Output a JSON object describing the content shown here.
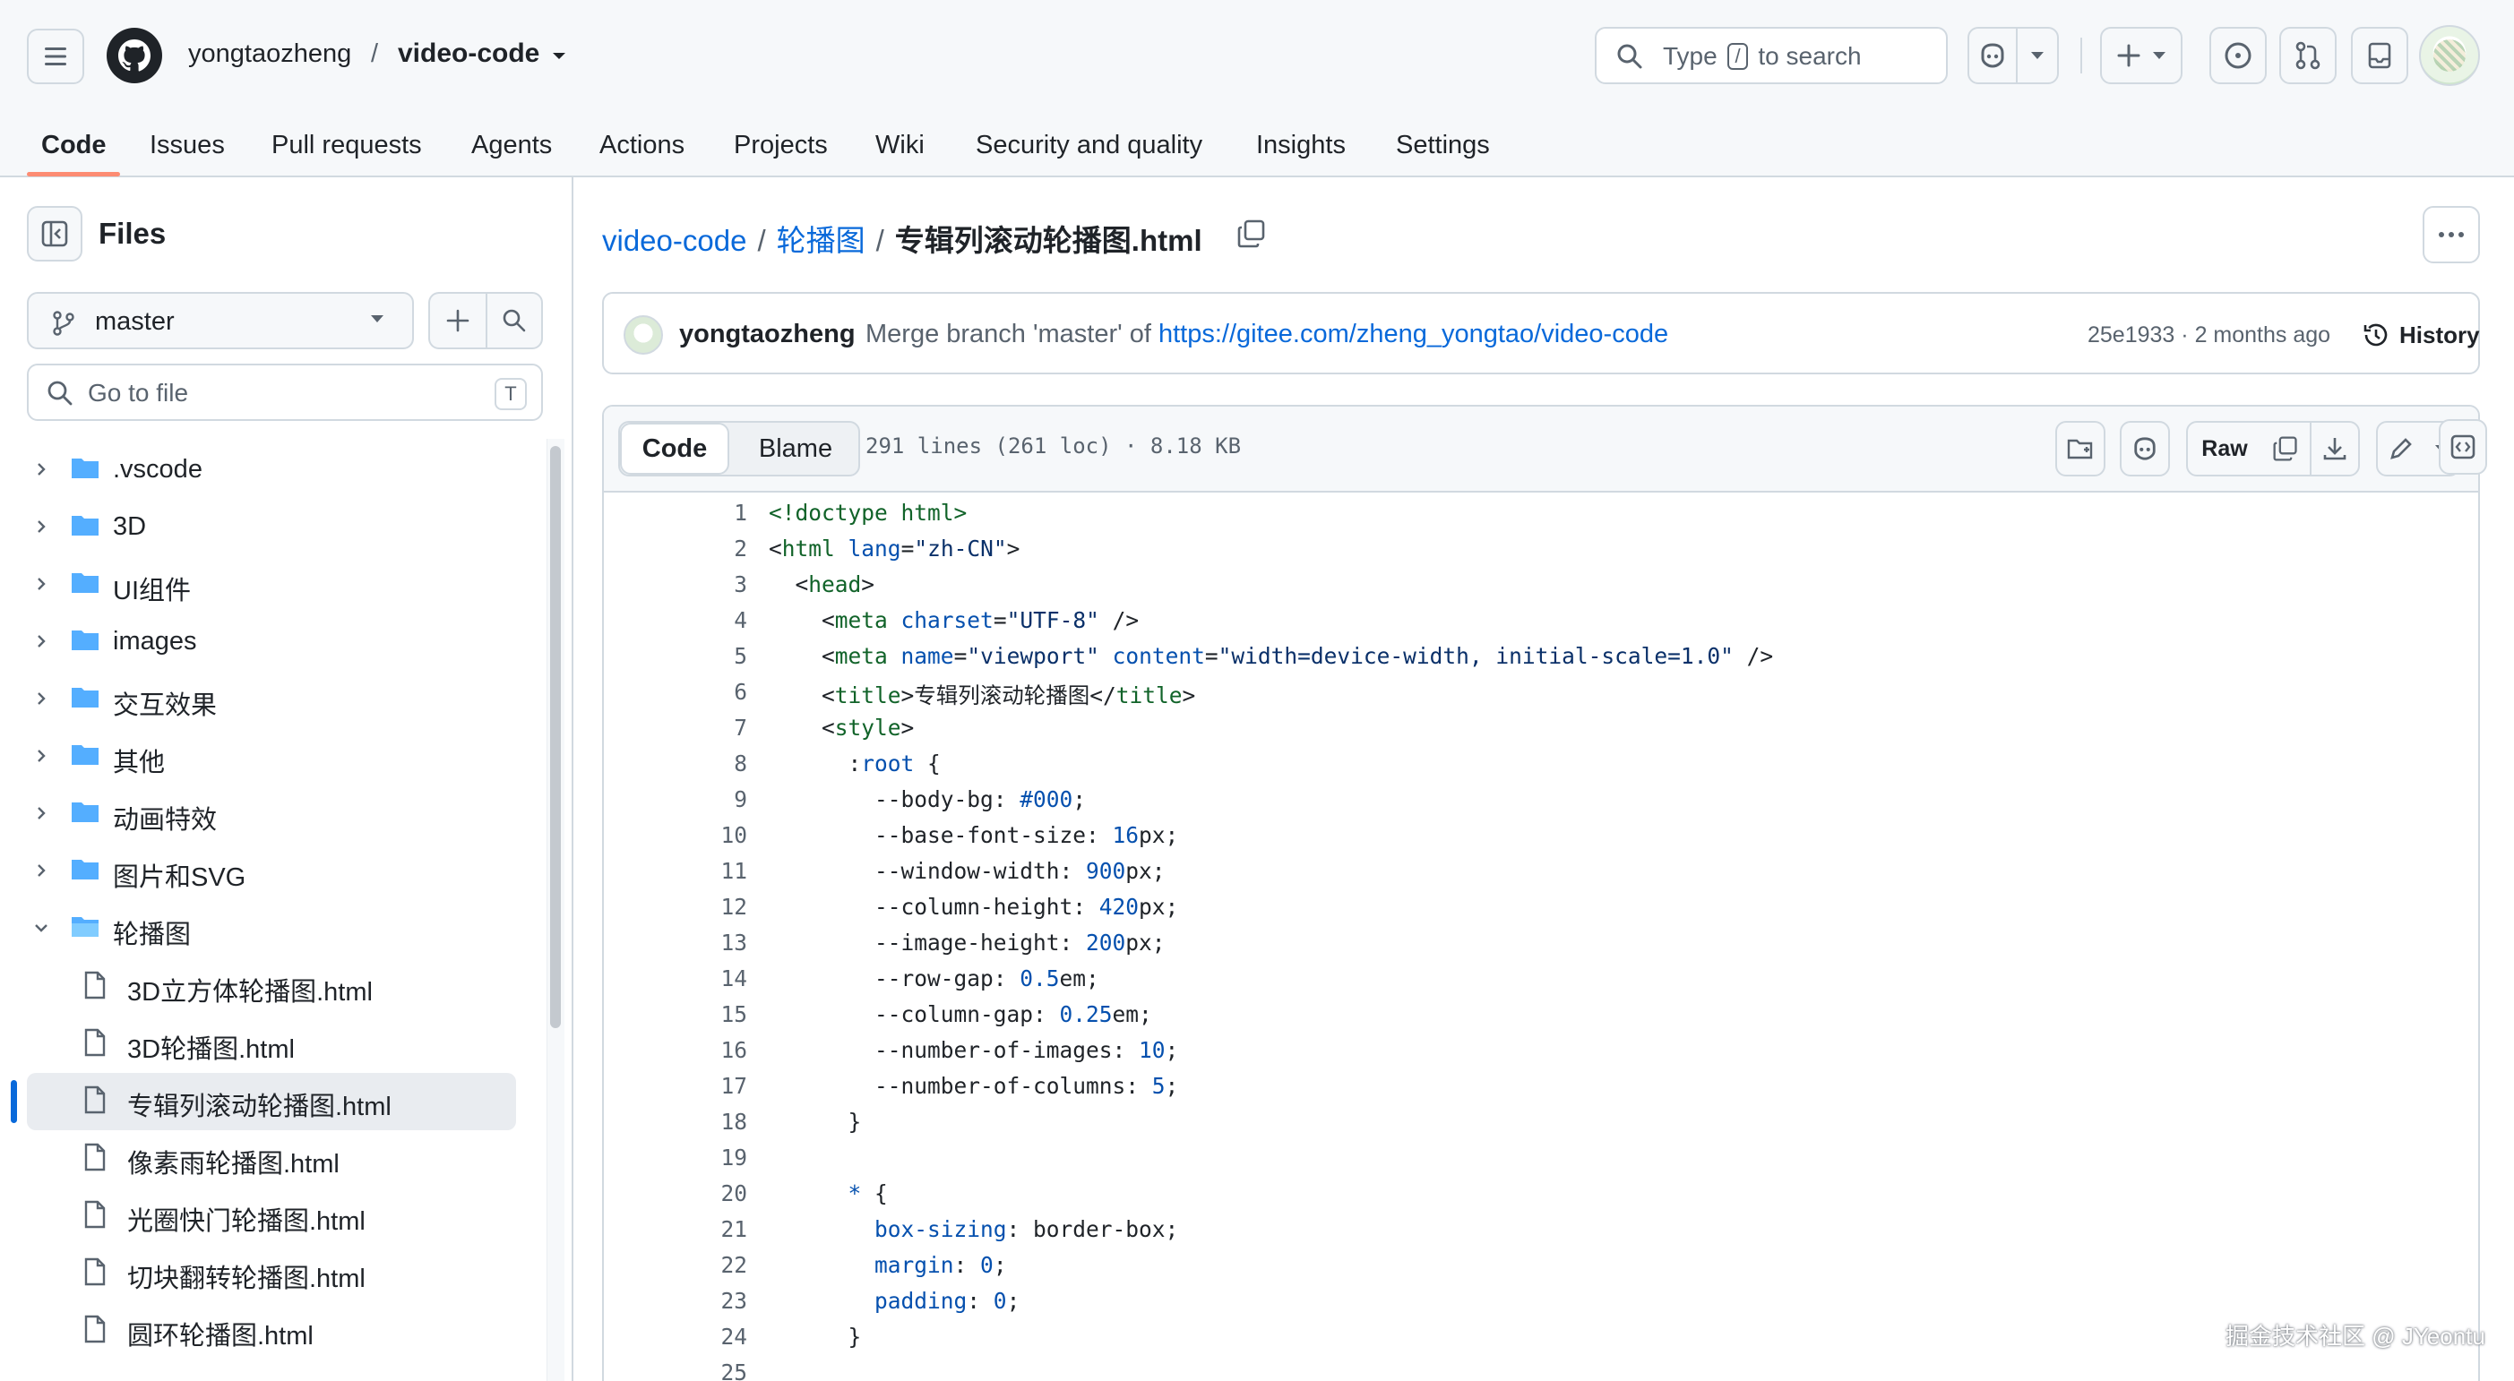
{
  "header": {
    "owner": "yongtaozheng",
    "separator": "/",
    "repo": "video-code",
    "search_prefix": "Type",
    "search_key": "/",
    "search_suffix": "to search",
    "tabs": [
      {
        "label": "Code",
        "active": true
      },
      {
        "label": "Issues"
      },
      {
        "label": "Pull requests"
      },
      {
        "label": "Agents"
      },
      {
        "label": "Actions"
      },
      {
        "label": "Projects"
      },
      {
        "label": "Wiki"
      },
      {
        "label": "Security and quality"
      },
      {
        "label": "Insights"
      },
      {
        "label": "Settings"
      }
    ]
  },
  "sidebar": {
    "title": "Files",
    "branch": "master",
    "goto_placeholder": "Go to file",
    "goto_key": "T",
    "tree": [
      {
        "type": "folder",
        "name": ".vscode",
        "expanded": false
      },
      {
        "type": "folder",
        "name": "3D",
        "expanded": false
      },
      {
        "type": "folder",
        "name": "UI组件",
        "expanded": false
      },
      {
        "type": "folder",
        "name": "images",
        "expanded": false
      },
      {
        "type": "folder",
        "name": "交互效果",
        "expanded": false
      },
      {
        "type": "folder",
        "name": "其他",
        "expanded": false
      },
      {
        "type": "folder",
        "name": "动画特效",
        "expanded": false
      },
      {
        "type": "folder",
        "name": "图片和SVG",
        "expanded": false
      },
      {
        "type": "folder",
        "name": "轮播图",
        "expanded": true
      },
      {
        "type": "file",
        "name": "3D立方体轮播图.html"
      },
      {
        "type": "file",
        "name": "3D轮播图.html"
      },
      {
        "type": "file",
        "name": "专辑列滚动轮播图.html",
        "selected": true
      },
      {
        "type": "file",
        "name": "像素雨轮播图.html"
      },
      {
        "type": "file",
        "name": "光圈快门轮播图.html"
      },
      {
        "type": "file",
        "name": "切块翻转轮播图.html"
      },
      {
        "type": "file",
        "name": "圆环轮播图.html"
      }
    ]
  },
  "main": {
    "path": {
      "repo": "video-code",
      "folder": "轮播图",
      "file": "专辑列滚动轮播图.html",
      "sep": "/"
    },
    "commit": {
      "author": "yongtaozheng",
      "message": "Merge branch 'master' of",
      "link": "https://gitee.com/zheng_yongtao/video-code",
      "sha": "25e1933",
      "dot": "·",
      "age": "2 months ago",
      "history_label": "History"
    },
    "file": {
      "tab_code": "Code",
      "tab_blame": "Blame",
      "info": "291 lines (261 loc) · 8.18 KB",
      "raw_label": "Raw"
    },
    "code_lines": [
      {
        "n": "1",
        "html": "<span class='t-tag'>&lt;!doctype html&gt;</span>"
      },
      {
        "n": "2",
        "html": "&lt;<span class='t-tag'>html</span> <span class='t-kw'>lang</span>=<span class='t-str'>\"zh-CN\"</span>&gt;"
      },
      {
        "n": "3",
        "html": "  &lt;<span class='t-tag'>head</span>&gt;"
      },
      {
        "n": "4",
        "html": "    &lt;<span class='t-tag'>meta</span> <span class='t-kw'>charset</span>=<span class='t-str'>\"UTF-8\"</span> /&gt;"
      },
      {
        "n": "5",
        "html": "    &lt;<span class='t-tag'>meta</span> <span class='t-kw'>name</span>=<span class='t-str'>\"viewport\"</span> <span class='t-kw'>content</span>=<span class='t-str'>\"width=device-width, initial-scale=1.0\"</span> /&gt;"
      },
      {
        "n": "6",
        "html": "    &lt;<span class='t-tag'>title</span>&gt;专辑列滚动轮播图&lt;/<span class='t-tag'>title</span>&gt;"
      },
      {
        "n": "7",
        "html": "    &lt;<span class='t-tag'>style</span>&gt;"
      },
      {
        "n": "8",
        "html": "      :<span class='t-kw'>root</span> {"
      },
      {
        "n": "9",
        "html": "        --body-bg: <span class='t-kw'>#000</span>;"
      },
      {
        "n": "10",
        "html": "        --base-font-size: <span class='t-kw'>16</span>px;"
      },
      {
        "n": "11",
        "html": "        --window-width: <span class='t-kw'>900</span>px;"
      },
      {
        "n": "12",
        "html": "        --column-height: <span class='t-kw'>420</span>px;"
      },
      {
        "n": "13",
        "html": "        --image-height: <span class='t-kw'>200</span>px;"
      },
      {
        "n": "14",
        "html": "        --row-gap: <span class='t-kw'>0.5</span>em;"
      },
      {
        "n": "15",
        "html": "        --column-gap: <span class='t-kw'>0.25</span>em;"
      },
      {
        "n": "16",
        "html": "        --number-of-images: <span class='t-kw'>10</span>;"
      },
      {
        "n": "17",
        "html": "        --number-of-columns: <span class='t-kw'>5</span>;"
      },
      {
        "n": "18",
        "html": "      }"
      },
      {
        "n": "19",
        "html": ""
      },
      {
        "n": "20",
        "html": "      <span class='t-kw'>*</span> {"
      },
      {
        "n": "21",
        "html": "        <span class='t-prop'>box-sizing</span>: border-box;"
      },
      {
        "n": "22",
        "html": "        <span class='t-prop'>margin</span>: <span class='t-kw'>0</span>;"
      },
      {
        "n": "23",
        "html": "        <span class='t-prop'>padding</span>: <span class='t-kw'>0</span>;"
      },
      {
        "n": "24",
        "html": "      }"
      },
      {
        "n": "25",
        "html": ""
      }
    ]
  },
  "watermark": "掘金技术社区 @ JYeontu",
  "colors": {
    "link": "#0969da",
    "accent": "#fd8c73",
    "selected_bar": "#0969da",
    "folder": "#54aeff"
  }
}
